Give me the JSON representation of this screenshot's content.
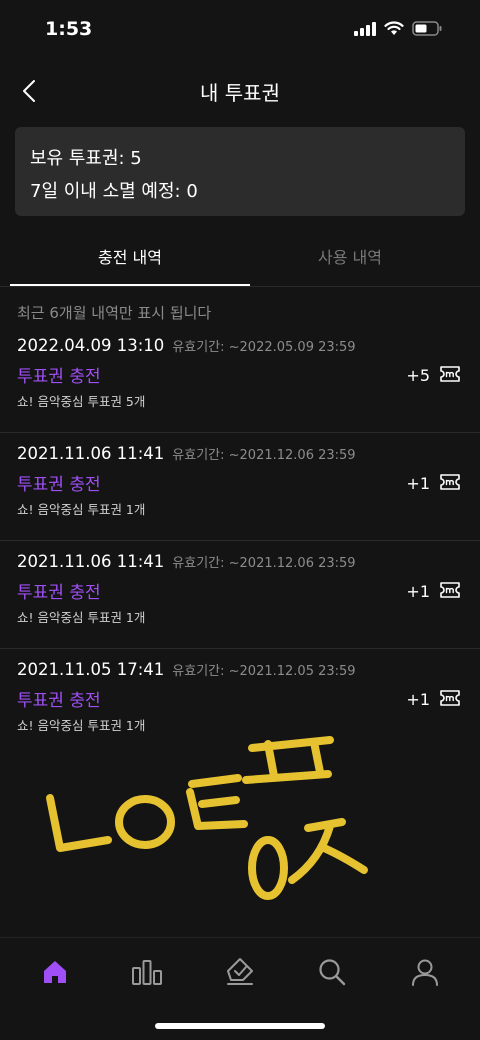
{
  "status_bar": {
    "time": "1:53"
  },
  "header": {
    "title": "내 투표권",
    "back_icon": "chevron-left-icon"
  },
  "summary": {
    "owned": "보유 투표권: 5",
    "expiring": "7일 이내 소멸 예정: 0"
  },
  "tabs": [
    {
      "label": "충전 내역",
      "active": true
    },
    {
      "label": "사용 내역",
      "active": false
    }
  ],
  "notice": "최근 6개월 내역만 표시 됩니다",
  "history": [
    {
      "date": "2022.04.09 13:10",
      "expiry": "유효기간: ~2022.05.09 23:59",
      "title": "투표권 충전",
      "desc": "쇼! 음악중심 투표권 5개",
      "amount": "+5"
    },
    {
      "date": "2021.11.06 11:41",
      "expiry": "유효기간: ~2021.12.06 23:59",
      "title": "투표권 충전",
      "desc": "쇼! 음악중심 투표권 1개",
      "amount": "+1"
    },
    {
      "date": "2021.11.06 11:41",
      "expiry": "유효기간: ~2021.12.06 23:59",
      "title": "투표권 충전",
      "desc": "쇼! 음악중심 투표권 1개",
      "amount": "+1"
    },
    {
      "date": "2021.11.05 17:41",
      "expiry": "유효기간: ~2021.12.05 23:59",
      "title": "투표권 충전",
      "desc": "쇼! 음악중심 투표권 1개",
      "amount": "+1"
    }
  ],
  "colors": {
    "accent": "#9f4ff5",
    "handwriting": "#e6c230",
    "background": "#141414",
    "card": "#2c2c2c"
  },
  "bottom_nav": [
    {
      "icon": "home-icon",
      "active": true
    },
    {
      "icon": "chart-icon",
      "active": false
    },
    {
      "icon": "vote-icon",
      "active": false
    },
    {
      "icon": "search-icon",
      "active": false
    },
    {
      "icon": "profile-icon",
      "active": false
    }
  ]
}
